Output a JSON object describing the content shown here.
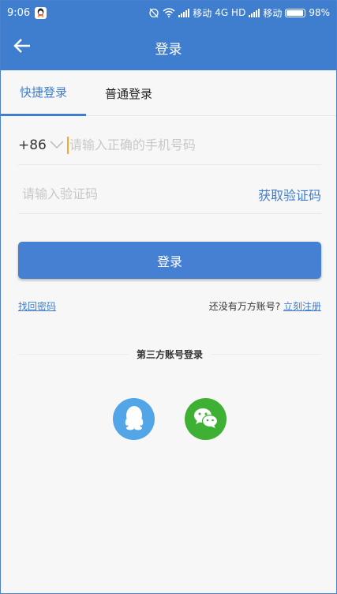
{
  "status_bar": {
    "time": "9:06",
    "carrier1": "移动",
    "network": "4G HD",
    "carrier2": "移动",
    "battery": "98%"
  },
  "app_bar": {
    "title": "登录",
    "back_icon": "arrow-left-icon"
  },
  "tabs": [
    {
      "label": "快捷登录",
      "active": true
    },
    {
      "label": "普通登录",
      "active": false
    }
  ],
  "form": {
    "country_code": "+86",
    "phone_placeholder": "请输入正确的手机号码",
    "code_placeholder": "请输入验证码",
    "get_code_label": "获取验证码",
    "login_label": "登录"
  },
  "links": {
    "forgot_password": "找回密码",
    "no_account": "还没有万方账号?",
    "register": "立刻注册"
  },
  "third_party": {
    "label": "第三方账号登录",
    "providers": [
      "qq-icon",
      "wechat-icon"
    ]
  },
  "colors": {
    "primary": "#3f7ece",
    "qq": "#52a5e6",
    "wechat": "#3eb135"
  }
}
